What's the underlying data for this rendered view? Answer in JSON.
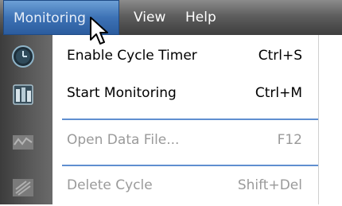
{
  "menubar": {
    "items": [
      {
        "label": "Monitoring"
      },
      {
        "label": "View"
      },
      {
        "label": "Help"
      }
    ]
  },
  "menu": {
    "items": [
      {
        "label": "Enable Cycle Timer",
        "shortcut": "Ctrl+S",
        "icon": "clock-icon",
        "enabled": true
      },
      {
        "label": "Start Monitoring",
        "shortcut": "Ctrl+M",
        "icon": "monitor-icon",
        "enabled": true
      },
      {
        "label": "Open Data File...",
        "shortcut": "F12",
        "icon": "wave-icon",
        "enabled": false
      },
      {
        "label": "Delete Cycle",
        "shortcut": "Shift+Del",
        "icon": "delete-cycle-icon",
        "enabled": false
      }
    ]
  },
  "colors": {
    "accent": "#3d72b5",
    "separator": "#5f8fd0",
    "disabled_text": "#9a9a9a"
  }
}
